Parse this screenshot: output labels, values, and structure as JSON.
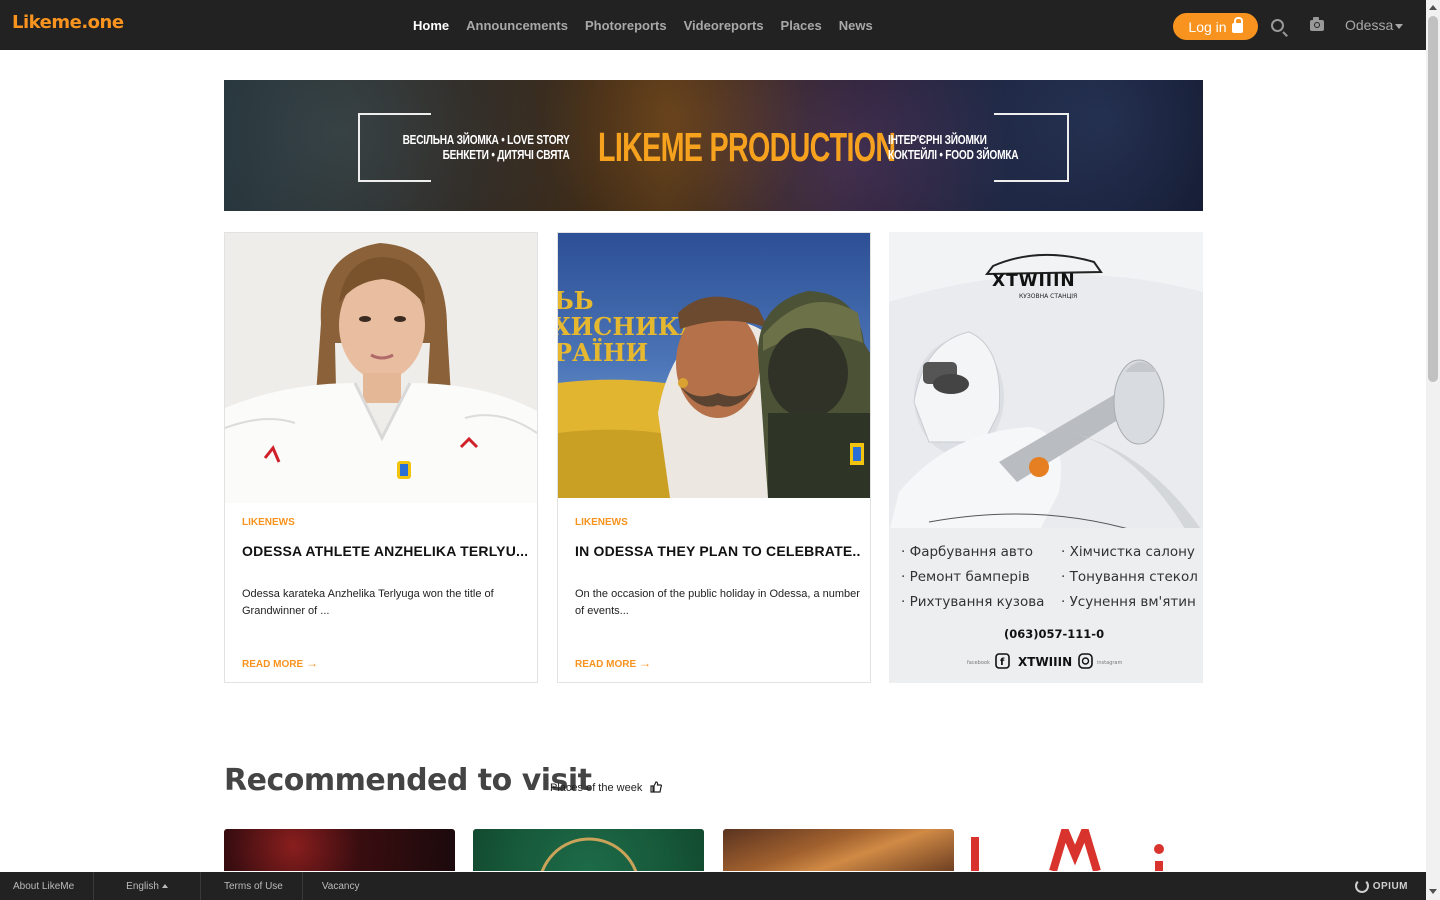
{
  "header": {
    "logo_a": "Likeme",
    "logo_b": ".one",
    "nav": [
      "Home",
      "Announcements",
      "Photoreports",
      "Videoreports",
      "Places",
      "News"
    ],
    "login_label": "Log in",
    "city": "Odessa"
  },
  "banner": {
    "left_line1": "ВЕСІЛЬНА ЗЙОМКА • LOVE STORY",
    "left_line2": "БЕНКЕТИ • ДИТЯЧІ СВЯТА",
    "title": "LIKEME PRODUCTION",
    "right_line1": "ІНТЕР'ЄРНІ ЗЙОМКИ",
    "right_line2": "КОКТЕЙЛІ • FOOD ЗЙОМКА"
  },
  "cards": [
    {
      "category": "LIKENEWS",
      "title": "ODESSA ATHLETE ANZHELIKA TERLYU...",
      "excerpt": "Odessa karateka Anzhelika Terlyuga won the title of Grandwinner of ...",
      "more": "READ MORE"
    },
    {
      "category": "LIKENEWS",
      "title": "IN ODESSA THEY PLAN TO CELEBRATE...",
      "excerpt": "On the occasion of the public holiday in Odessa, a number of events...",
      "more": "READ MORE",
      "image_text_1": "ЬЬ",
      "image_text_2": "ХИСНИКА",
      "image_text_3": "РАЇНИ"
    }
  ],
  "ad": {
    "brand": "XTWIIIN",
    "tagline": "КУЗОВНА СТАНЦІЯ",
    "services_left": [
      "· Фарбування авто",
      "· Ремонт бамперів",
      "· Рихтування кузова"
    ],
    "services_right": [
      "· Хімчистка салону",
      "· Тонування стекол",
      "· Усунення вм'ятин"
    ],
    "phone": "(063)057-111-0",
    "facebook": "facebook",
    "instagram": "instagram"
  },
  "section": {
    "title": "Recommended to visit",
    "subtitle": "Places of the week"
  },
  "footer": {
    "about": "About LikeMe",
    "language": "English",
    "terms": "Terms of Use",
    "vacancy": "Vacancy",
    "brand": "OPIUM"
  },
  "colors": {
    "accent": "#f7931e",
    "topbar": "#222222"
  }
}
